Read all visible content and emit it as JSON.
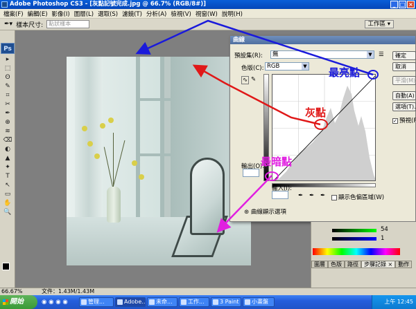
{
  "window": {
    "title": "Adobe Photoshop CS3 - [灰點記號完成.jpg @ 66.7% (RGB/8#)]"
  },
  "menu": [
    "檔案(F)",
    "編輯(E)",
    "影像(I)",
    "圖層(L)",
    "選取(S)",
    "濾鏡(T)",
    "分析(A)",
    "檢視(V)",
    "視窗(W)",
    "說明(H)"
  ],
  "options": {
    "label": "樣本尺寸:",
    "value": "點狀樣本",
    "workspace": "工作區 ▾"
  },
  "tools": {
    "logo": "Ps",
    "glyphs": [
      "▸",
      "⬚",
      "ʘ",
      "✎",
      "⌗",
      "✂",
      "✒",
      "⊕",
      "≋",
      "⌫",
      "◐",
      "▲",
      "✦",
      "T",
      "↖",
      "▭",
      "✋",
      "🔍"
    ]
  },
  "curves": {
    "title": "曲線",
    "preset_label": "預設集(R):",
    "preset_value": "無",
    "channel_label": "色版(C):",
    "channel_value": "RGB",
    "output_label": "輸出(O):",
    "input_label": "輸入(I):",
    "clip_label": "顯示色偏區域(W)",
    "display_options": "曲線顯示選項",
    "buttons": [
      "確定",
      "取消",
      "平滑(M)",
      "自動(A)",
      "選項(T)..."
    ],
    "preview_label": "預視(P)"
  },
  "panels": {
    "val1": "54",
    "val2": "1",
    "tabs": [
      "圖層",
      "色版",
      "路徑",
      "步驟記錄 ×",
      "動作"
    ]
  },
  "status": {
    "zoom": "66.67%",
    "doc": "文件：1.43M/1.43M"
  },
  "taskbar": {
    "start": "開始",
    "tasks": [
      "管理...",
      "Adobe...",
      "未命...",
      "工作...",
      "3 Paint",
      "小畫盤"
    ],
    "clock": "上午 12:45"
  },
  "annotations": {
    "highlight": "最亮點",
    "gray": "灰點",
    "shadow": "最暗點"
  },
  "colors": {
    "blue_arrow": "#1a1adb",
    "red_arrow": "#e01818",
    "magenta_arrow": "#e020e0"
  }
}
